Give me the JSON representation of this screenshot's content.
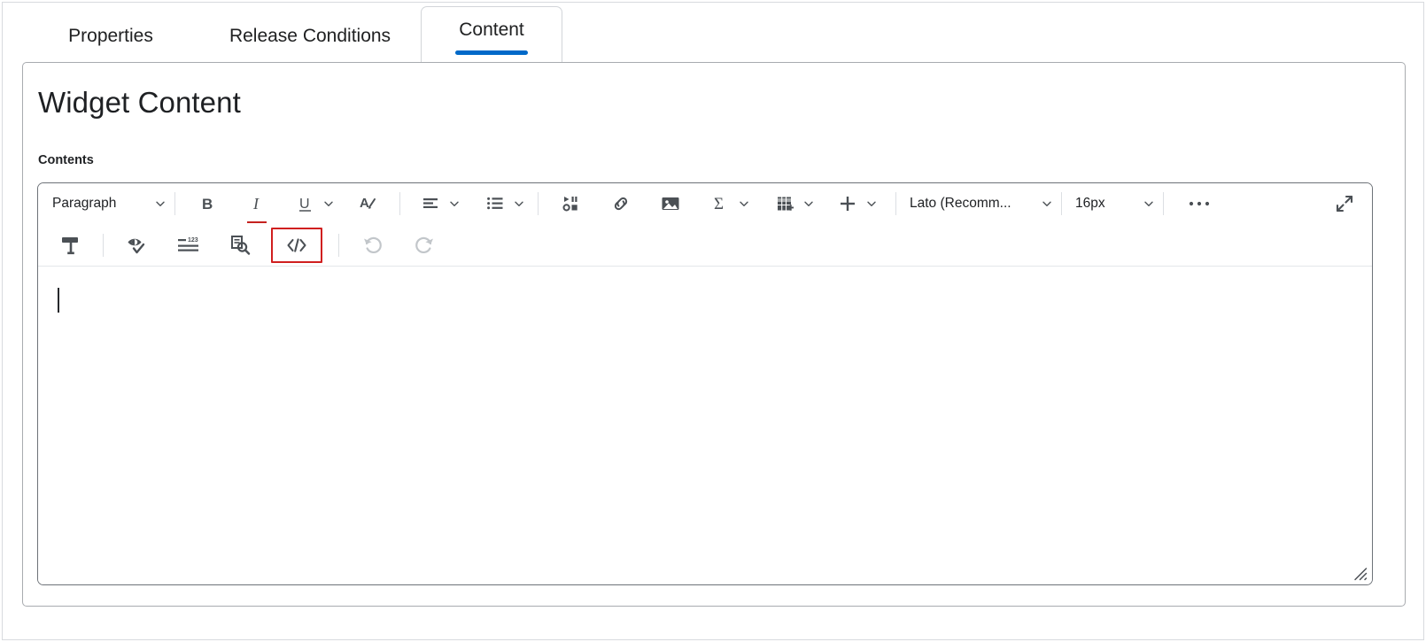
{
  "tabs": [
    {
      "label": "Properties",
      "active": false
    },
    {
      "label": "Release Conditions",
      "active": false
    },
    {
      "label": "Content",
      "active": true
    }
  ],
  "page": {
    "title": "Widget Content",
    "field_label": "Contents"
  },
  "editor": {
    "body_text": "",
    "toolbar_row1": {
      "paragraph_style": "Paragraph",
      "font_family": "Lato (Recomm...",
      "font_size": "16px",
      "buttons": [
        {
          "name": "paragraph-style-dropdown",
          "label": "Paragraph",
          "icon": "chevron-down-icon"
        },
        {
          "name": "bold-button",
          "label": "Bold",
          "icon": "bold-icon"
        },
        {
          "name": "italic-button",
          "label": "Italic",
          "icon": "italic-icon"
        },
        {
          "name": "underline-button",
          "label": "Underline",
          "icon": "underline-icon"
        },
        {
          "name": "text-color-button",
          "label": "Text Color",
          "icon": "text-color-icon"
        },
        {
          "name": "align-button",
          "label": "Align",
          "icon": "align-left-icon"
        },
        {
          "name": "list-button",
          "label": "Lists",
          "icon": "bulleted-list-icon"
        },
        {
          "name": "insert-media-button",
          "label": "Insert Media",
          "icon": "media-icon"
        },
        {
          "name": "insert-link-button",
          "label": "Insert Link",
          "icon": "link-icon"
        },
        {
          "name": "insert-image-button",
          "label": "Insert Image",
          "icon": "image-icon"
        },
        {
          "name": "equation-button",
          "label": "Equation",
          "icon": "sigma-icon"
        },
        {
          "name": "table-button",
          "label": "Table",
          "icon": "table-icon"
        },
        {
          "name": "insert-stuff-button",
          "label": "Insert",
          "icon": "plus-icon"
        },
        {
          "name": "font-family-dropdown",
          "label": "Lato (Recomm...",
          "icon": "chevron-down-icon"
        },
        {
          "name": "font-size-dropdown",
          "label": "16px",
          "icon": "chevron-down-icon"
        },
        {
          "name": "more-options-button",
          "label": "More",
          "icon": "ellipsis-icon"
        },
        {
          "name": "fullscreen-button",
          "label": "Fullscreen",
          "icon": "expand-icon"
        }
      ]
    },
    "toolbar_row2": {
      "buttons": [
        {
          "name": "format-painter-button",
          "label": "Format Painter",
          "icon": "paint-roller-icon"
        },
        {
          "name": "accessibility-checker-button",
          "label": "Accessibility Checker",
          "icon": "eye-check-icon"
        },
        {
          "name": "word-count-button",
          "label": "Word Count",
          "icon": "word-count-icon"
        },
        {
          "name": "preview-button",
          "label": "Preview",
          "icon": "document-search-icon"
        },
        {
          "name": "html-source-editor-button",
          "label": "HTML Source Editor",
          "icon": "code-icon",
          "highlighted": true
        },
        {
          "name": "undo-button",
          "label": "Undo",
          "icon": "undo-icon",
          "disabled": true
        },
        {
          "name": "redo-button",
          "label": "Redo",
          "icon": "redo-icon",
          "disabled": true
        }
      ]
    },
    "resize_handle": "resize-grip-icon"
  },
  "colors": {
    "accent_blue": "#0069c8",
    "highlight_red": "#d01f1f",
    "icon_gray": "#4b5055",
    "disabled_gray": "#c2c6ca"
  }
}
